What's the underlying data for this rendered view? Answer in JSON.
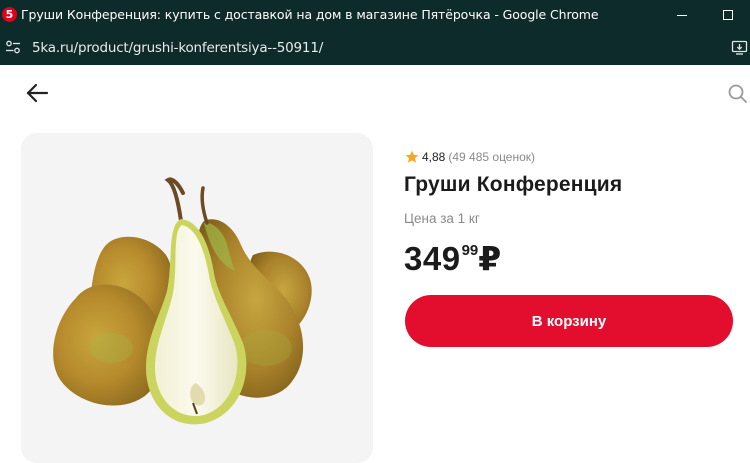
{
  "browser": {
    "window_title": "Груши Конференция: купить с доставкой на дом в магазине Пятёрочка - Google Chrome",
    "favicon_label": "5",
    "url": "5ka.ru/product/grushi-konferentsiya--50911/",
    "icons": {
      "site_info": "tune-icon",
      "install": "install-app-icon",
      "minimize": "minimize-icon",
      "maximize": "maximize-icon"
    }
  },
  "nav": {
    "back_icon": "arrow-left-icon",
    "search_icon": "search-icon"
  },
  "product": {
    "image_alt": "pears",
    "rating": "4,88",
    "rating_count": "(49 485 оценок)",
    "title": "Груши Конференция",
    "price_unit": "Цена за 1 кг",
    "price_main": "349",
    "price_kopecks": "99",
    "currency": "₽",
    "cart_button": "В корзину"
  },
  "colors": {
    "chrome_bg": "#0d2b2a",
    "accent": "#e30e2e",
    "star": "#f5a623",
    "card_bg": "#f4f4f5"
  }
}
